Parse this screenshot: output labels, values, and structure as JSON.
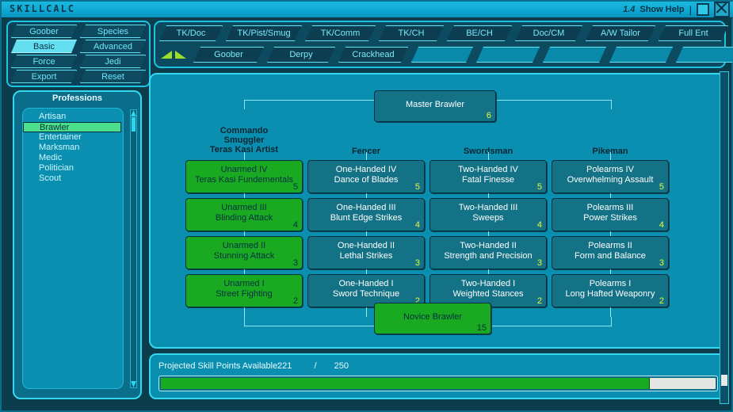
{
  "window": {
    "title": "SKILLCALC",
    "version": "1.4",
    "help_label": "Show Help",
    "separator": "|",
    "maximize_icon": "maximize-icon",
    "close_icon": "close-icon"
  },
  "left_buttons": {
    "rows": [
      [
        {
          "label": "Goober",
          "active": false
        },
        {
          "label": "Species",
          "active": false
        }
      ],
      [
        {
          "label": "Basic",
          "active": true
        },
        {
          "label": "Advanced",
          "active": false
        }
      ],
      [
        {
          "label": "Force",
          "active": false
        },
        {
          "label": "Jedi",
          "active": false
        }
      ],
      [
        {
          "label": "Export",
          "active": false
        },
        {
          "label": "Reset",
          "active": false
        }
      ]
    ]
  },
  "tabs": {
    "row1": [
      {
        "label": "TK/Doc",
        "width": 80
      },
      {
        "label": "TK/Pist/Smug",
        "width": 96
      },
      {
        "label": "TK/Comm",
        "width": 89
      },
      {
        "label": "TK/CH",
        "width": 82
      },
      {
        "label": "BE/CH",
        "width": 82
      },
      {
        "label": "Doc/CM",
        "width": 85
      },
      {
        "label": "A/W Tailor",
        "width": 88
      },
      {
        "label": "Full Ent",
        "width": 88
      }
    ],
    "row2": [
      {
        "label": "Goober",
        "width": 89,
        "empty": false
      },
      {
        "label": "Derpy",
        "width": 86,
        "empty": false
      },
      {
        "label": "Crackhead",
        "width": 88,
        "empty": false
      },
      {
        "label": "",
        "width": 78,
        "empty": true
      },
      {
        "label": "",
        "width": 80,
        "empty": true
      },
      {
        "label": "",
        "width": 80,
        "empty": true
      },
      {
        "label": "",
        "width": 80,
        "empty": true
      },
      {
        "label": "",
        "width": 80,
        "empty": true
      }
    ],
    "arrows_icon": "double-triangle-arrows-icon"
  },
  "professions": {
    "title": "Professions",
    "items": [
      {
        "label": "Artisan",
        "selected": false
      },
      {
        "label": "Brawler",
        "selected": true
      },
      {
        "label": "Entertainer",
        "selected": false
      },
      {
        "label": "Marksman",
        "selected": false
      },
      {
        "label": "Medic",
        "selected": false
      },
      {
        "label": "Politician",
        "selected": false
      },
      {
        "label": "Scout",
        "selected": false
      }
    ],
    "scroll_up_icon": "scroll-up-arrow-icon",
    "scroll_down_icon": "scroll-down-arrow-icon"
  },
  "tree": {
    "master": {
      "title": "Master Brawler",
      "sub": "",
      "num": "6",
      "state": "teal"
    },
    "novice": {
      "title": "Novice Brawler",
      "sub": "",
      "num": "15",
      "state": "green"
    },
    "columns": [
      {
        "heading": "Commando\nSmuggler\nTeras Kasi Artist",
        "heading_lines": [
          "Commando",
          "Smuggler",
          "Teras Kasi Artist"
        ],
        "boxes": [
          {
            "title": "Unarmed IV",
            "sub": "Teras Kasi Fundementals",
            "num": "5",
            "state": "green"
          },
          {
            "title": "Unarmed III",
            "sub": "Blinding Attack",
            "num": "4",
            "state": "green"
          },
          {
            "title": "Unarmed II",
            "sub": "Stunning Attack",
            "num": "3",
            "state": "green"
          },
          {
            "title": "Unarmed I",
            "sub": "Street Fighting",
            "num": "2",
            "state": "green"
          }
        ]
      },
      {
        "heading_lines": [
          "Fencer"
        ],
        "boxes": [
          {
            "title": "One-Handed IV",
            "sub": "Dance of Blades",
            "num": "5",
            "state": "teal"
          },
          {
            "title": "One-Handed III",
            "sub": "Blunt Edge Strikes",
            "num": "4",
            "state": "teal"
          },
          {
            "title": "One-Handed II",
            "sub": "Lethal Strikes",
            "num": "3",
            "state": "teal"
          },
          {
            "title": "One-Handed I",
            "sub": "Sword Technique",
            "num": "2",
            "state": "teal"
          }
        ]
      },
      {
        "heading_lines": [
          "Swordsman"
        ],
        "boxes": [
          {
            "title": "Two-Handed IV",
            "sub": "Fatal Finesse",
            "num": "5",
            "state": "teal"
          },
          {
            "title": "Two-Handed III",
            "sub": "Sweeps",
            "num": "4",
            "state": "teal"
          },
          {
            "title": "Two-Handed II",
            "sub": "Strength and Precision",
            "num": "3",
            "state": "teal"
          },
          {
            "title": "Two-Handed I",
            "sub": "Weighted Stances",
            "num": "2",
            "state": "teal"
          }
        ]
      },
      {
        "heading_lines": [
          "Pikeman"
        ],
        "boxes": [
          {
            "title": "Polearms IV",
            "sub": "Overwhelming Assault",
            "num": "5",
            "state": "teal"
          },
          {
            "title": "Polearms III",
            "sub": "Power Strikes",
            "num": "4",
            "state": "teal"
          },
          {
            "title": "Polearms II",
            "sub": "Form and Balance",
            "num": "3",
            "state": "teal"
          },
          {
            "title": "Polearms I",
            "sub": "Long Hafted Weaponry",
            "num": "2",
            "state": "teal"
          }
        ]
      }
    ]
  },
  "status": {
    "label": "Projected Skill Points Available:",
    "current": "221",
    "slash": "/",
    "total": "250",
    "progress_percent": 88
  },
  "colors": {
    "accent_cyan": "#2ee0f5",
    "panel_teal": "#0a8fb0",
    "selected_green": "#1aaa22",
    "list_highlight_green": "#4bdf8b",
    "number_yellow": "#e9f93d",
    "titlebar_blue": "#19b9e0"
  }
}
